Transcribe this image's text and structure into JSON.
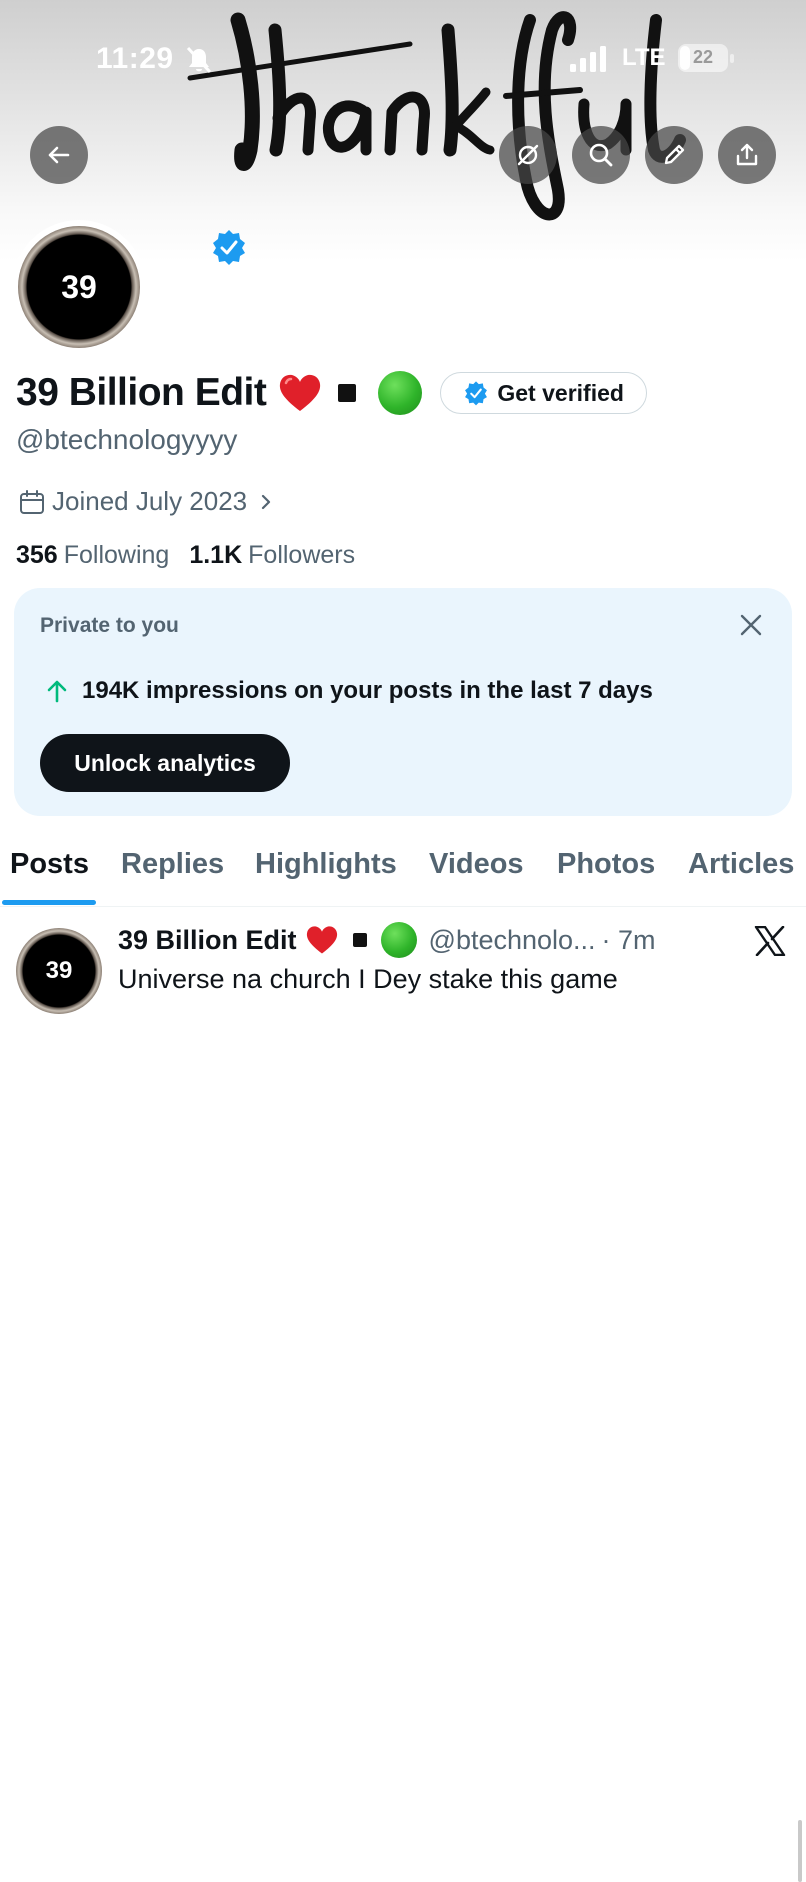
{
  "status_bar": {
    "time": "11:29",
    "network": "LTE",
    "battery": "22",
    "battery_level": 0.22
  },
  "banner": {
    "art_text": "thankful"
  },
  "icons": {
    "back": "arrow-left-icon",
    "grok": "grok-icon",
    "search": "search-icon",
    "edit": "pencil-icon",
    "share": "share-icon",
    "verified": "verified-badge-icon",
    "calendar": "calendar-icon",
    "x_logo": "x-logo-icon"
  },
  "colors": {
    "accent": "#1d9bf0",
    "secondary_text": "#536471",
    "card_bg": "#eaf5fd",
    "impression_arrow": "#00ba7c"
  },
  "profile": {
    "avatar_text": "39",
    "display_name": "39 Billion Edit",
    "name_emojis": [
      "red-heart",
      "black-square",
      "green-circle"
    ],
    "get_verified_label": "Get verified",
    "handle": "@btechnologyyyy",
    "joined": "Joined July 2023",
    "following_count": "356",
    "following_label": "Following",
    "followers_count": "1.1K",
    "followers_label": "Followers"
  },
  "analytics_card": {
    "label": "Private to you",
    "stat_text": "194K impressions on your posts in the last 7 days",
    "button_label": "Unlock analytics"
  },
  "tabs": [
    {
      "label": "Posts",
      "active": true
    },
    {
      "label": "Replies",
      "active": false
    },
    {
      "label": "Highlights",
      "active": false
    },
    {
      "label": "Videos",
      "active": false
    },
    {
      "label": "Photos",
      "active": false
    },
    {
      "label": "Articles",
      "active": false
    }
  ],
  "post": {
    "avatar_text": "39",
    "author_name": "39 Billion Edit",
    "author_handle": "@btechnolo...",
    "time": "· 7m",
    "text": "Universe na church I Dey stake this game"
  }
}
